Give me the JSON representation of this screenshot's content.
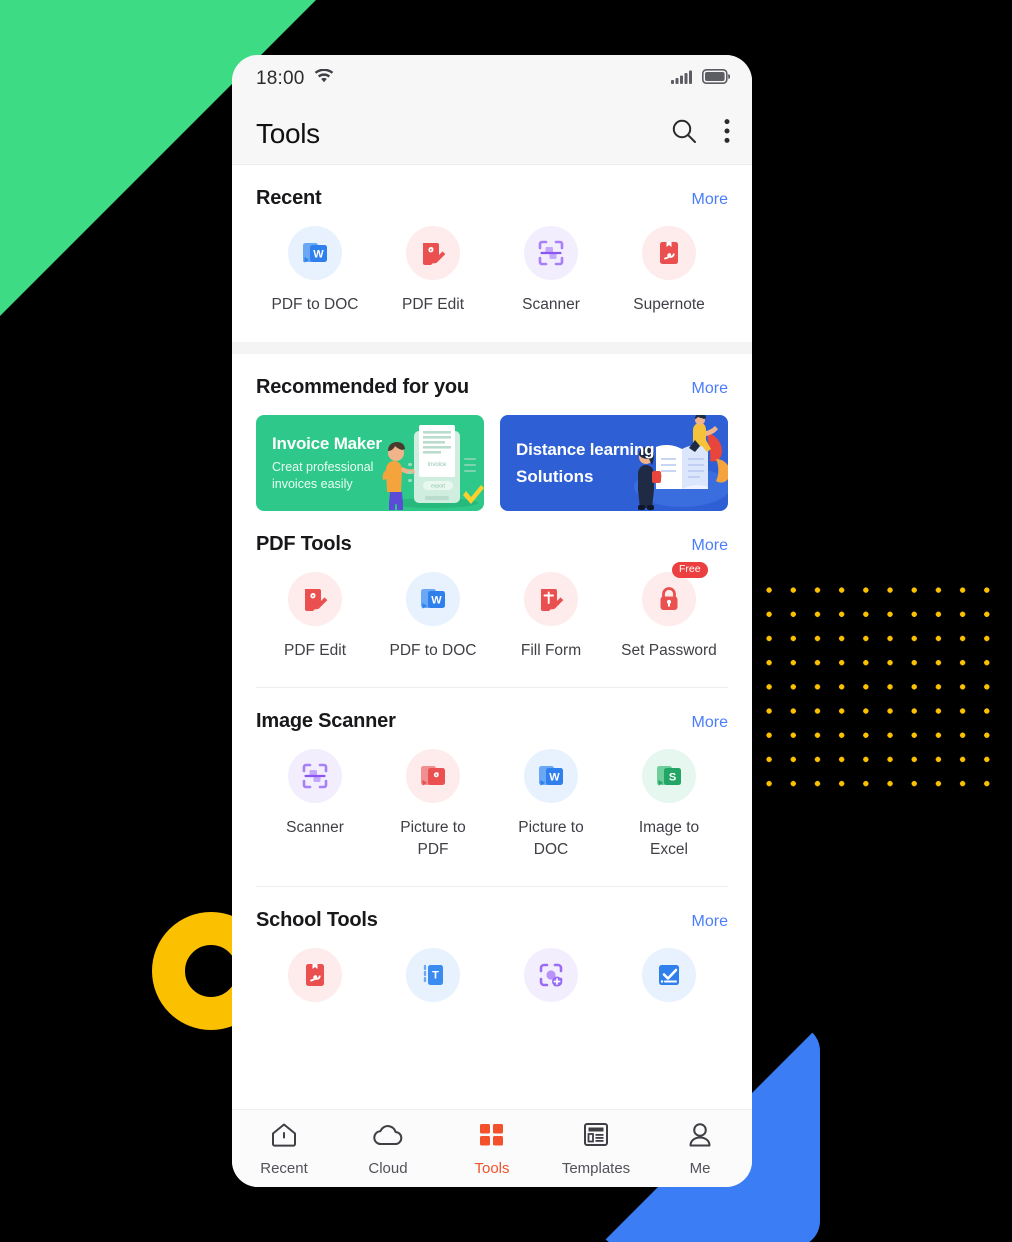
{
  "decor": {
    "green_shape": "green-triangle",
    "blue_shape": "blue-triangle",
    "yellow_ring": "yellow-ring",
    "dot_grid": "yellow-dot-grid",
    "colors": {
      "green": "#3ddc84",
      "blue": "#3b7df5",
      "yellow": "#fbc000",
      "background": "#000000"
    }
  },
  "statusbar": {
    "time": "18:00",
    "wifi_icon": "wifi-icon",
    "signal_icon": "cellular-signal-icon",
    "battery_icon": "battery-icon"
  },
  "appbar": {
    "title": "Tools",
    "search_icon": "search-icon",
    "overflow_icon": "more-vertical-icon"
  },
  "sections": [
    {
      "id": "recent",
      "title": "Recent",
      "more_label": "More",
      "tiles": [
        {
          "label": "PDF to DOC",
          "icon": "pdf-to-doc-icon",
          "bg": "#e8f1fe",
          "fg": "#2f80ed"
        },
        {
          "label": "PDF Edit",
          "icon": "pdf-edit-icon",
          "bg": "#fdeceb",
          "fg": "#ea5050"
        },
        {
          "label": "Scanner",
          "icon": "scanner-icon",
          "bg": "#f3eefe",
          "fg": "#9a6cf5"
        },
        {
          "label": "Supernote",
          "icon": "supernote-icon",
          "bg": "#fdeceb",
          "fg": "#ea5050"
        }
      ]
    },
    {
      "id": "recommended",
      "title": "Recommended for you",
      "more_label": "More",
      "banners": [
        {
          "title": "Invoice Maker",
          "subtitle": "Creat professional\ninvoices easily",
          "color": "#2ec98a",
          "art": "invoice-illustration"
        },
        {
          "title": "Distance learning",
          "title2": "Solutions",
          "color": "#2f5fd4",
          "art": "distance-learning-illustration"
        }
      ]
    },
    {
      "id": "pdf-tools",
      "title": "PDF Tools",
      "more_label": "More",
      "tiles": [
        {
          "label": "PDF Edit",
          "icon": "pdf-edit-icon",
          "bg": "#fdeceb",
          "fg": "#ea5050"
        },
        {
          "label": "PDF to DOC",
          "icon": "pdf-to-doc-icon",
          "bg": "#e8f1fe",
          "fg": "#2f80ed"
        },
        {
          "label": "Fill Form",
          "icon": "fill-form-icon",
          "bg": "#fdeceb",
          "fg": "#ea5050"
        },
        {
          "label": "Set Password",
          "icon": "lock-icon",
          "bg": "#fdeceb",
          "fg": "#ea5050",
          "badge": "Free"
        }
      ]
    },
    {
      "id": "image-scanner",
      "title": "Image Scanner",
      "more_label": "More",
      "tiles": [
        {
          "label": "Scanner",
          "icon": "scanner-icon",
          "bg": "#f3eefe",
          "fg": "#9a6cf5"
        },
        {
          "label": "Picture to PDF",
          "icon": "picture-to-pdf-icon",
          "bg": "#fdeceb",
          "fg": "#ea5050"
        },
        {
          "label": "Picture to DOC",
          "icon": "picture-to-doc-icon",
          "bg": "#e8f1fe",
          "fg": "#2f80ed"
        },
        {
          "label": "Image to Excel",
          "icon": "image-to-excel-icon",
          "bg": "#e6f7ef",
          "fg": "#23a665"
        }
      ]
    },
    {
      "id": "school-tools",
      "title": "School Tools",
      "more_label": "More",
      "tiles": [
        {
          "label": "",
          "icon": "supernote-icon",
          "bg": "#fdeceb",
          "fg": "#ea5050"
        },
        {
          "label": "",
          "icon": "text-recognition-icon",
          "bg": "#e8f1fe",
          "fg": "#3b8cf0"
        },
        {
          "label": "",
          "icon": "scan-translate-icon",
          "bg": "#f3eefe",
          "fg": "#9a6cf5"
        },
        {
          "label": "",
          "icon": "checklist-doc-icon",
          "bg": "#e8f1fe",
          "fg": "#2f80ed"
        }
      ]
    }
  ],
  "navbar": {
    "active": "Tools",
    "active_color": "#f2512c",
    "items": [
      {
        "label": "Recent",
        "icon": "home-icon"
      },
      {
        "label": "Cloud",
        "icon": "cloud-icon"
      },
      {
        "label": "Tools",
        "icon": "grid-icon"
      },
      {
        "label": "Templates",
        "icon": "templates-icon"
      },
      {
        "label": "Me",
        "icon": "person-icon"
      }
    ]
  }
}
